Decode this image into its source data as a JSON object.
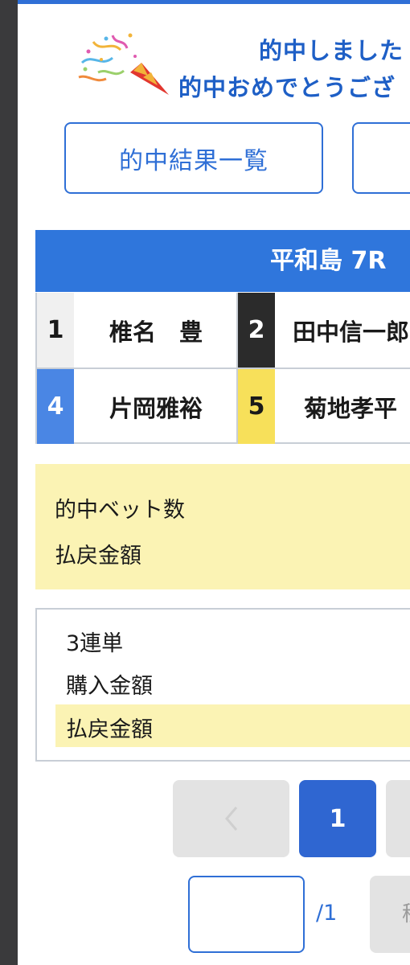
{
  "header": {
    "line1": "的中しました",
    "line2": "的中おめでとうござ"
  },
  "buttons": {
    "results_list": "的中結果一覧",
    "second": ""
  },
  "race": {
    "title": "平和島 7R",
    "racers": [
      {
        "number": "1",
        "name": "椎名　豊",
        "color": "#f0f0f0"
      },
      {
        "number": "2",
        "name": "田中信一郎",
        "color": "#2b2b2b"
      },
      {
        "number": "4",
        "name": "片岡雅裕",
        "color": "#4a86e4"
      },
      {
        "number": "5",
        "name": "菊地孝平",
        "color": "#f7e05a"
      }
    ]
  },
  "summary": {
    "hit_bet_count_label": "的中ベット数",
    "payout_label": "払戻金額"
  },
  "bet": {
    "type": "3連単",
    "purchase_label": "購入金額",
    "payout_label": "払戻金額"
  },
  "pagination": {
    "prev_icon": "chevron-left-icon",
    "current": "1"
  },
  "page_jump": {
    "value": "",
    "total": "/1",
    "go_label": "移"
  },
  "colors": {
    "accent": "#2f6fd6",
    "highlight": "#fbf3b4"
  }
}
